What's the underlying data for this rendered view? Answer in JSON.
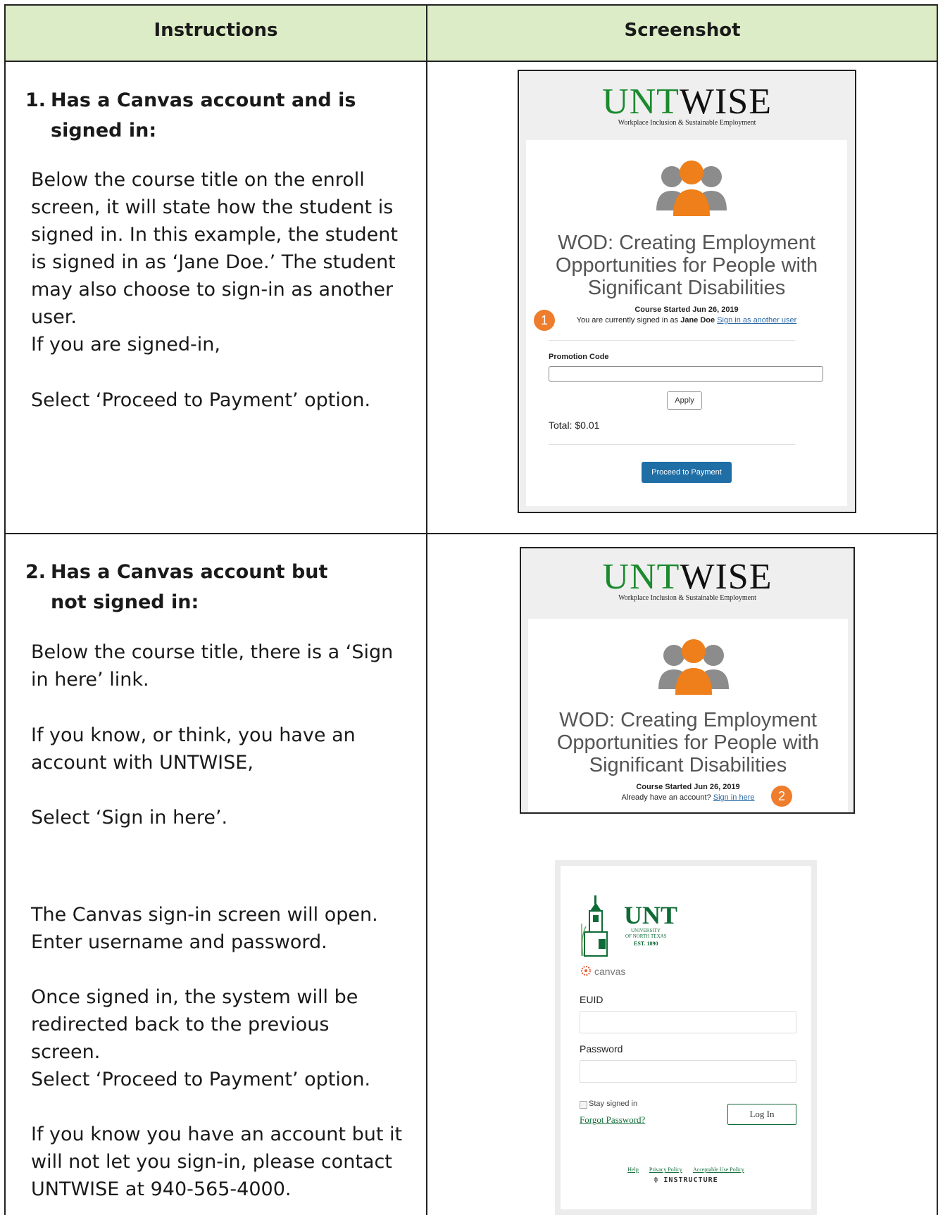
{
  "table": {
    "headers": [
      "Instructions",
      "Screenshot"
    ]
  },
  "section1": {
    "number": "1.",
    "title": "Has a Canvas account and is signed in:",
    "paragraphs": [
      "Below the course title on the enroll screen, it will state how the student is signed in. In this example, the student is signed in as ‘Jane Doe.’ The student may also choose to sign-in as another user.",
      "If you are signed-in,",
      "Select ‘Proceed to Payment’ option."
    ]
  },
  "section2": {
    "number": "2.",
    "title": "Has a Canvas account but not signed in:",
    "paragraphs": [
      "Below the course title, there is a ‘Sign in here’ link.",
      "If you know, or think, you have an account with UNTWISE,",
      "Select ‘Sign in here’.",
      "The Canvas sign-in screen will open. Enter username and password.",
      "Once signed in, the system will be redirected back to the previous screen.",
      "Select ‘Proceed to Payment’ option.",
      "If you know you have an account but it will not let you sign-in, please contact UNTWISE at 940-565-4000."
    ]
  },
  "shot1": {
    "brand_unt": "UNT",
    "brand_wise": "WISE",
    "brand_sub": "Workplace Inclusion & Sustainable Employment",
    "course_title_l1": "WOD: Creating Employment",
    "course_title_l2": "Opportunities for People with",
    "course_title_l3": "Significant Disabilities",
    "course_started": "Course Started Jun 26, 2019",
    "signed_in_prefix": "You are currently signed in as",
    "signed_in_user": "Jane Doe",
    "signed_in_link": "Sign in as another user",
    "badge": "1",
    "promo_label": "Promotion Code",
    "promo_value": "",
    "apply_label": "Apply",
    "total": "Total: $0.01",
    "pay_label": "Proceed to Payment"
  },
  "shot2": {
    "brand_unt": "UNT",
    "brand_wise": "WISE",
    "brand_sub": "Workplace Inclusion & Sustainable Employment",
    "course_title_l1": "WOD: Creating Employment",
    "course_title_l2": "Opportunities for People with",
    "course_title_l3": "Significant Disabilities",
    "course_started": "Course Started Jun 26, 2019",
    "account_prefix": "Already have an account?",
    "sign_in_link": "Sign in here",
    "badge": "2"
  },
  "login": {
    "unt": "UNT",
    "university_l1": "UNIVERSITY",
    "university_l2": "OF NORTH TEXAS",
    "est": "EST. 1890",
    "canvas_word": "canvas",
    "euid_label": "EUID",
    "euid_value": "",
    "password_label": "Password",
    "password_value": "",
    "stay_signed_in": "Stay signed in",
    "forgot": "Forgot Password?",
    "login_button": "Log In",
    "footer_links": [
      "Help",
      "Privacy Policy",
      "Acceptable Use Policy"
    ],
    "instructure": "INSTRUCTURE"
  },
  "colors": {
    "header_bg": "#dcecc6",
    "unt_green": "#1c8a2e",
    "badge_orange": "#ee7d2d",
    "pay_blue": "#1f6ea6"
  }
}
